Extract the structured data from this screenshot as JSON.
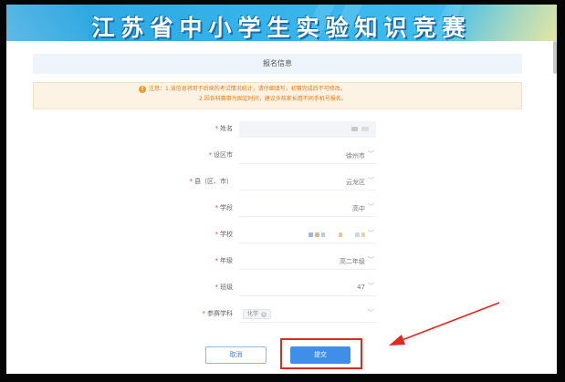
{
  "banner": {
    "title": "江苏省中小学生实验知识竞赛"
  },
  "section": {
    "title": "报名信息"
  },
  "notice": {
    "icon": "info-icon",
    "line1": "注意：1.该信息将用于后续的考试情况统计，请仔细填写，初赛完成后不可修改。",
    "line2": "2.因各科赛事为固定时间，建议多孩家长用不同手机号报名。"
  },
  "form": {
    "name": {
      "label": "姓名",
      "value": ""
    },
    "city": {
      "label": "设区市",
      "value": "徐州市"
    },
    "county": {
      "label": "县（区、市）",
      "value": "云龙区"
    },
    "stage": {
      "label": "学段",
      "value": "高中"
    },
    "school": {
      "label": "学校",
      "value": ""
    },
    "grade": {
      "label": "年级",
      "value": "高二年级"
    },
    "class": {
      "label": "班级",
      "value": "47"
    },
    "subject": {
      "label": "参赛学科",
      "tag": "化学"
    }
  },
  "buttons": {
    "cancel": "取消",
    "submit": "提交"
  },
  "colors": {
    "accent": "#3f8fe8",
    "highlight": "#e02a1f",
    "notice": "#ea7b16",
    "required": "#e64545"
  }
}
